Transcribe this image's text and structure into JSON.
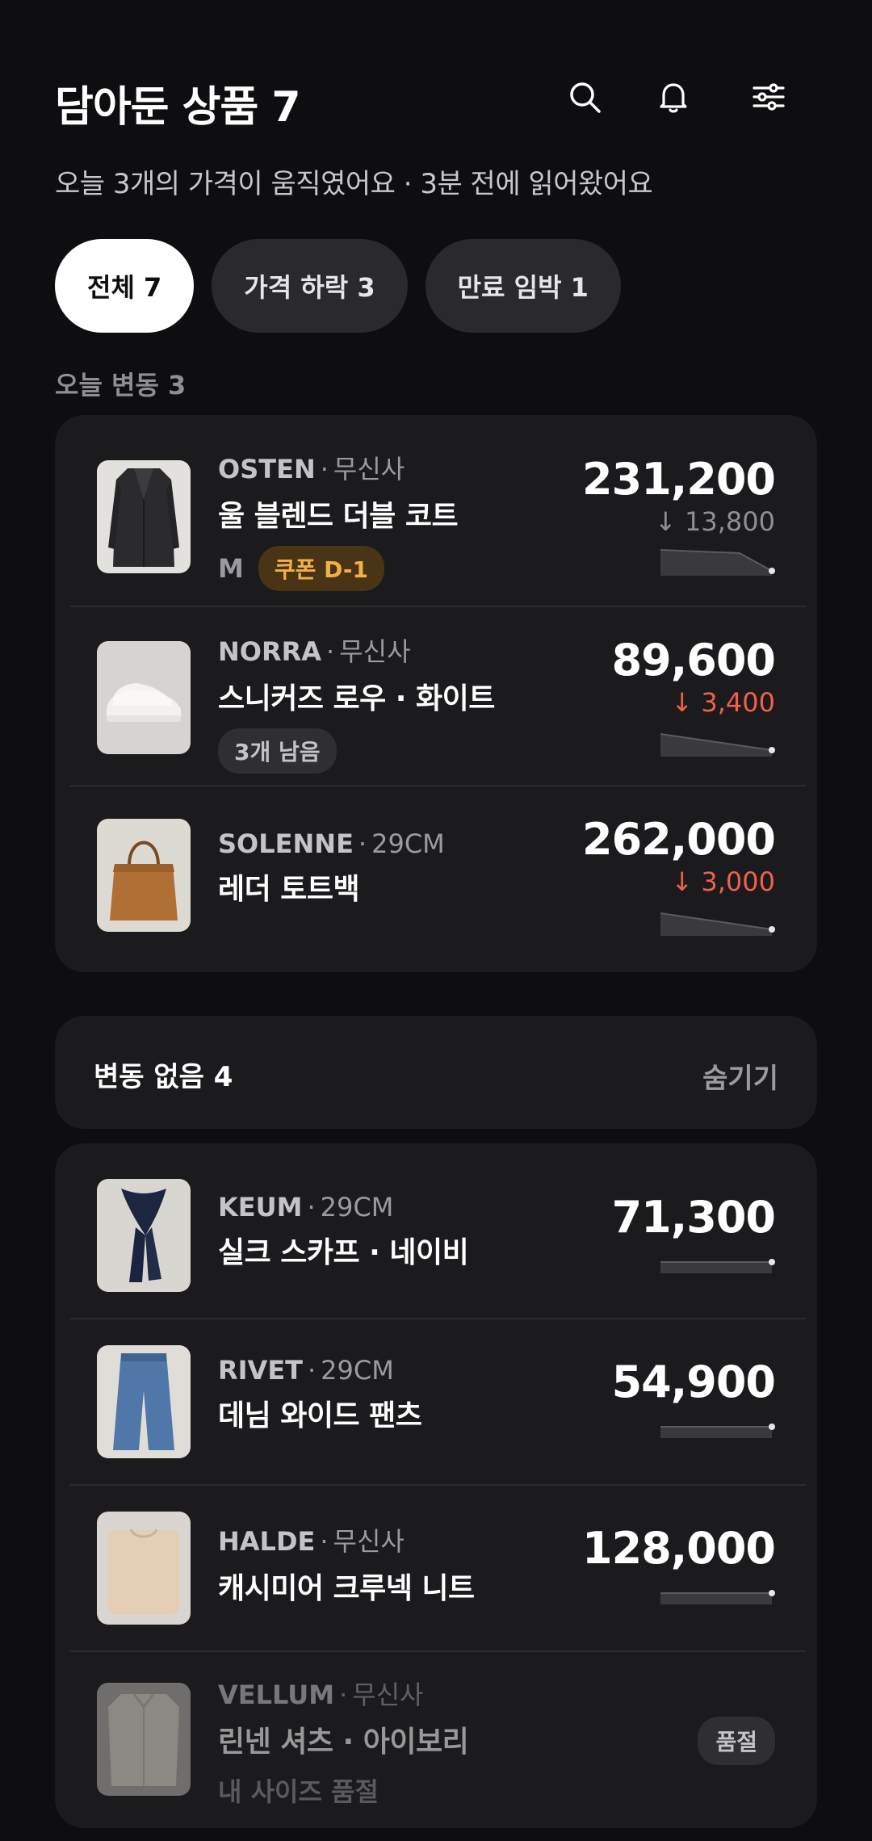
{
  "header": {
    "title": "담아둔 상품 7",
    "icons": [
      "search-icon",
      "bell-icon",
      "filter-icon"
    ]
  },
  "subtitle": "오늘 3개의 가격이 움직였어요 · 3분 전에 읽어왔어요",
  "chips": [
    {
      "label": "전체 7",
      "active": true
    },
    {
      "label": "가격 하락 3",
      "active": false
    },
    {
      "label": "만료 임박 1",
      "active": false
    }
  ],
  "section_changed": {
    "label": "오늘 변동 3",
    "items": [
      {
        "brand": "OSTEN",
        "store": "무신사",
        "name": "울 블렌드 더블 코트",
        "size": "M",
        "badge": "쿠폰 D-1",
        "price": "231,200",
        "delta": "↓ 13,800"
      },
      {
        "brand": "NORRA",
        "store": "무신사",
        "name": "스니커즈 로우 · 화이트",
        "badge": "3개 남음",
        "price": "89,600",
        "delta": "↓ 3,400"
      },
      {
        "brand": "SOLENNE",
        "store": "29CM",
        "name": "레더 토트백",
        "price": "262,000",
        "delta": "↓ 3,000"
      }
    ]
  },
  "section_nochange": {
    "title": "변동 없음 4",
    "toggle": "숨기기",
    "items": [
      {
        "brand": "KEUM",
        "store": "29CM",
        "name": "실크 스카프 · 네이비",
        "price": "71,300"
      },
      {
        "brand": "RIVET",
        "store": "29CM",
        "name": "데님 와이드 팬츠",
        "price": "54,900"
      },
      {
        "brand": "HALDE",
        "store": "무신사",
        "name": "캐시미어 크루넥 니트",
        "price": "128,000"
      },
      {
        "brand": "VELLUM",
        "store": "무신사",
        "name": "린넨 셔츠 · 아이보리",
        "note": "내 사이즈 품절",
        "status": "품절"
      }
    ]
  },
  "colors": {
    "background": "#0e0e10",
    "card": "#1b1b1e",
    "drop": "#f1604a",
    "coupon": "#f3b045"
  }
}
